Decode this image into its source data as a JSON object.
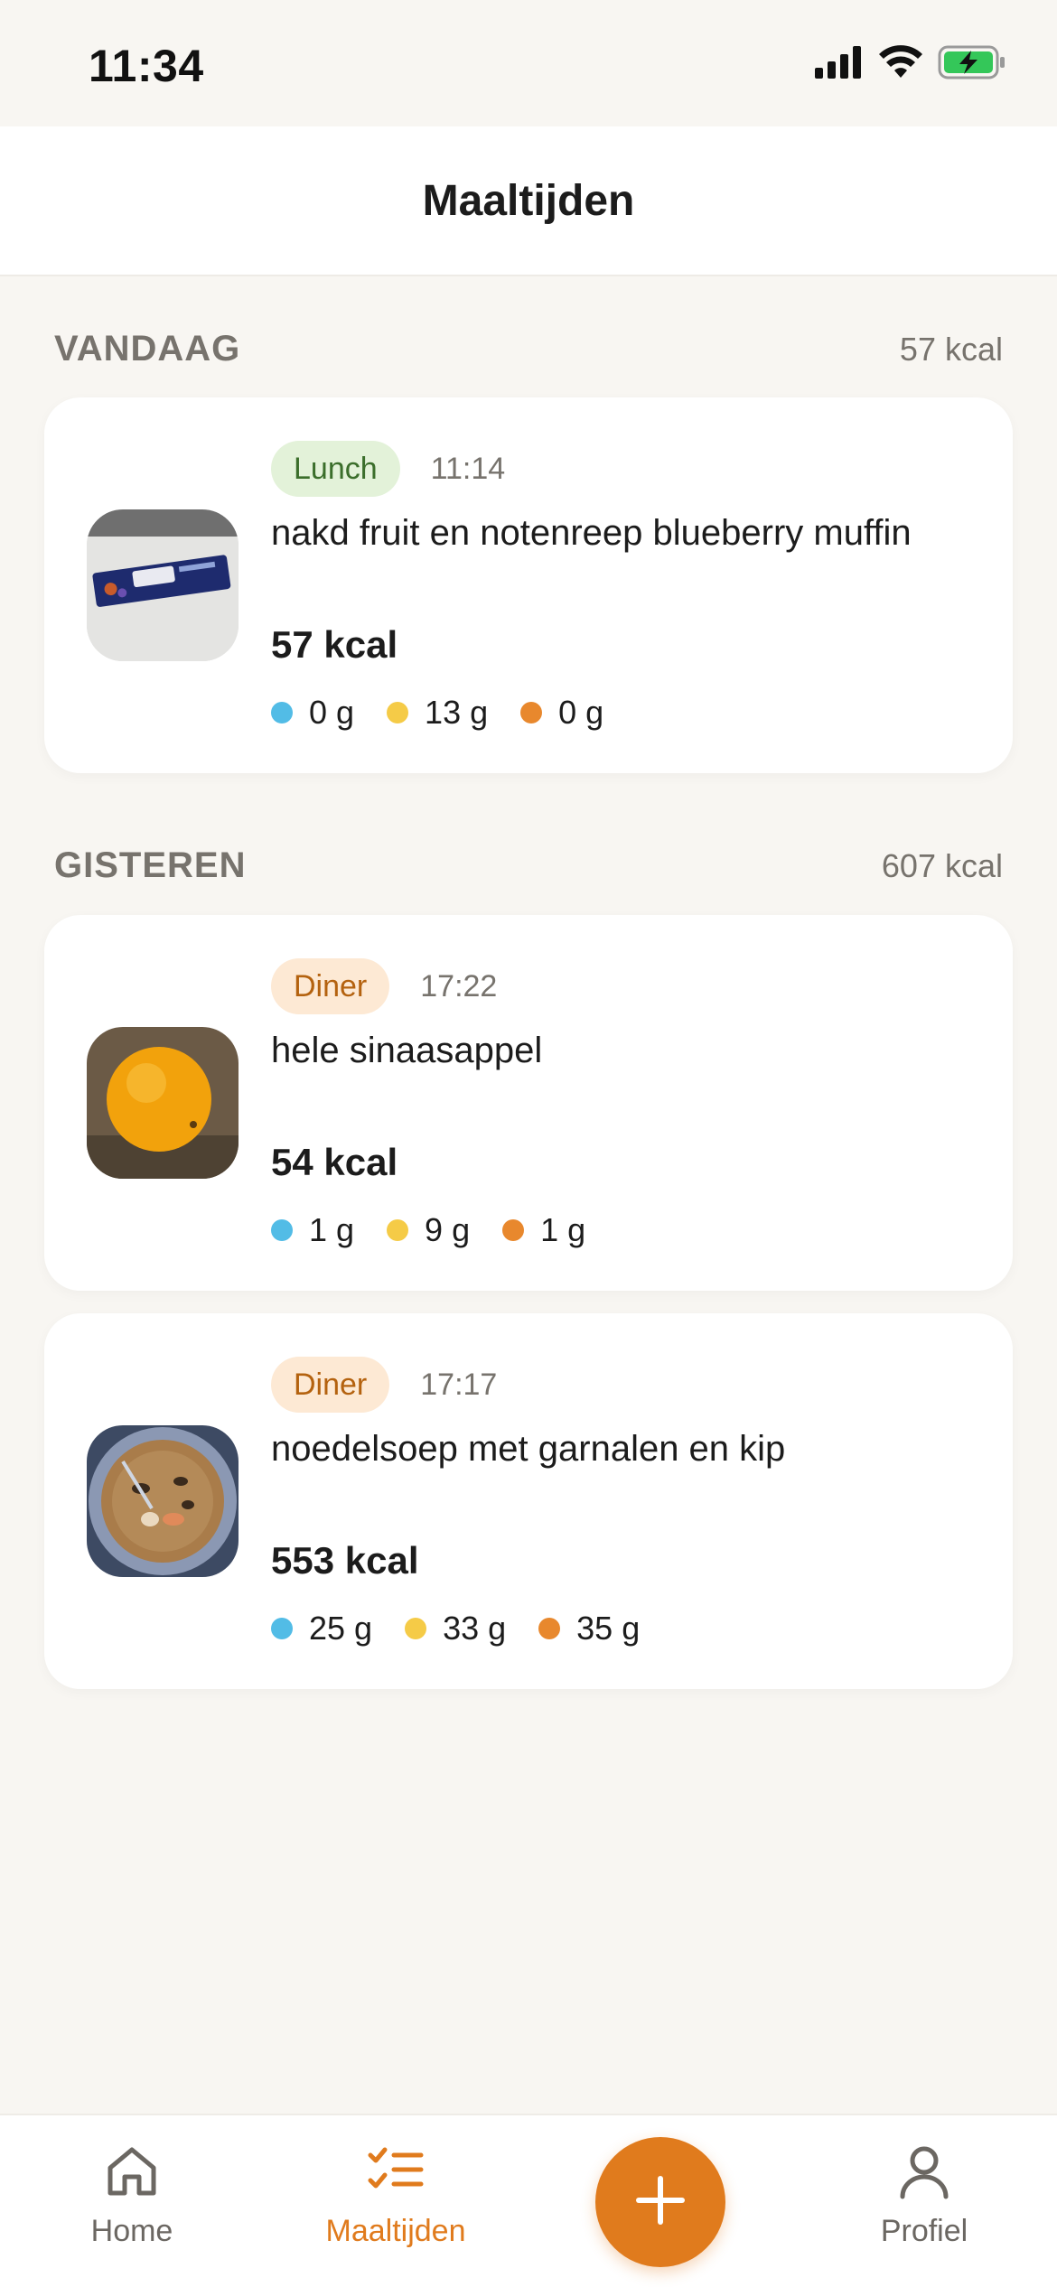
{
  "status_bar": {
    "time": "11:34"
  },
  "header": {
    "title": "Maaltijden"
  },
  "sections": [
    {
      "title": "VANDAAG",
      "total_kcal": "57 kcal",
      "meals": [
        {
          "tag": "Lunch",
          "time": "11:14",
          "name": "nakd fruit en notenreep blueberry muffin",
          "kcal": "57 kcal",
          "macros": {
            "protein": "0 g",
            "carbs": "13 g",
            "fat": "0 g"
          },
          "photo": "nakd-bar-photo"
        }
      ]
    },
    {
      "title": "GISTEREN",
      "total_kcal": "607 kcal",
      "meals": [
        {
          "tag": "Diner",
          "time": "17:22",
          "name": "hele sinaasappel",
          "kcal": "54 kcal",
          "macros": {
            "protein": "1 g",
            "carbs": "9 g",
            "fat": "1 g"
          },
          "photo": "orange-photo"
        },
        {
          "tag": "Diner",
          "time": "17:17",
          "name": "noedelsoep met garnalen en kip",
          "kcal": "553 kcal",
          "macros": {
            "protein": "25 g",
            "carbs": "33 g",
            "fat": "35 g"
          },
          "photo": "noodle-soup-photo"
        }
      ]
    }
  ],
  "nav": {
    "home": "Home",
    "meals": "Maaltijden",
    "profile": "Profiel",
    "add_icon": "plus-icon"
  },
  "colors": {
    "accent": "#e07b1d",
    "protein": "#52bce6",
    "carbs": "#f5cb47",
    "fat": "#e8882d",
    "lunch_tag_bg": "#e3f2d9",
    "diner_tag_bg": "#fde9d4"
  }
}
